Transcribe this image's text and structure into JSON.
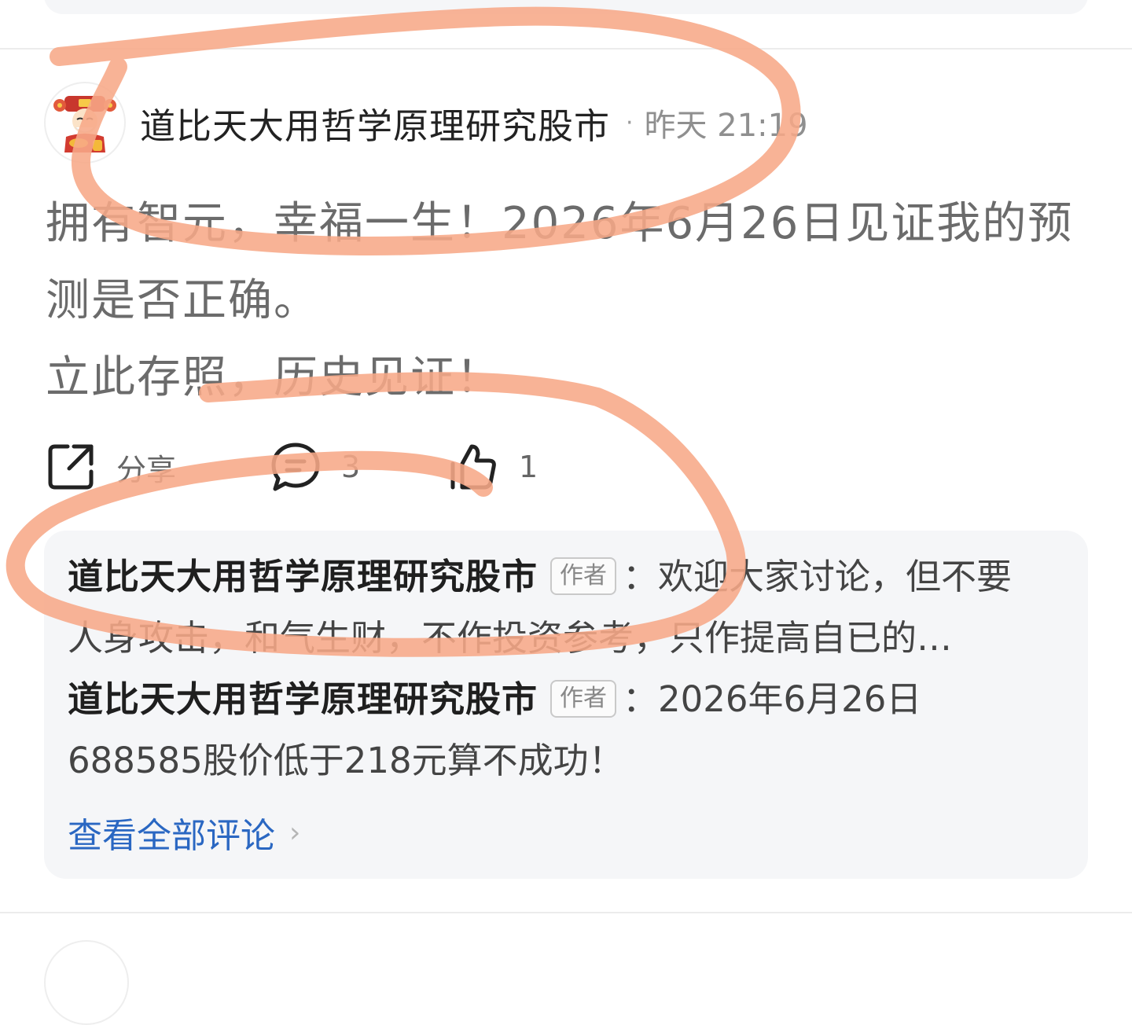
{
  "post": {
    "author": "道比天大用哲学原理研究股市",
    "separator": "·",
    "time": "昨天 21:19",
    "content_lines": [
      "拥有智元，幸福一生！2026年6月26日见证我的预测是否正确。",
      "立此存照，历史见证！"
    ],
    "actions": {
      "share_label": "分享",
      "comment_count": "3",
      "like_count": "1"
    }
  },
  "comments": {
    "items": [
      {
        "name": "道比天大用哲学原理研究股市",
        "tag": "作者",
        "text_line1": "：欢迎大家讨论，但不要",
        "text_line2": "人身攻击，和气生财，不作投资参考，只作提高自已的…"
      },
      {
        "name": "道比天大用哲学原理研究股市",
        "tag": "作者",
        "text_line1": "：2026年6月26日",
        "text_line2": "688585股价低于218元算不成功！"
      }
    ],
    "view_all": "查看全部评论"
  },
  "annotation_color": "#f7a887",
  "icons": {
    "avatar": "fortune-god-avatar",
    "share": "share-icon",
    "comment": "comment-icon",
    "like": "thumbs-up-icon",
    "chevron": "chevron-right-icon"
  }
}
